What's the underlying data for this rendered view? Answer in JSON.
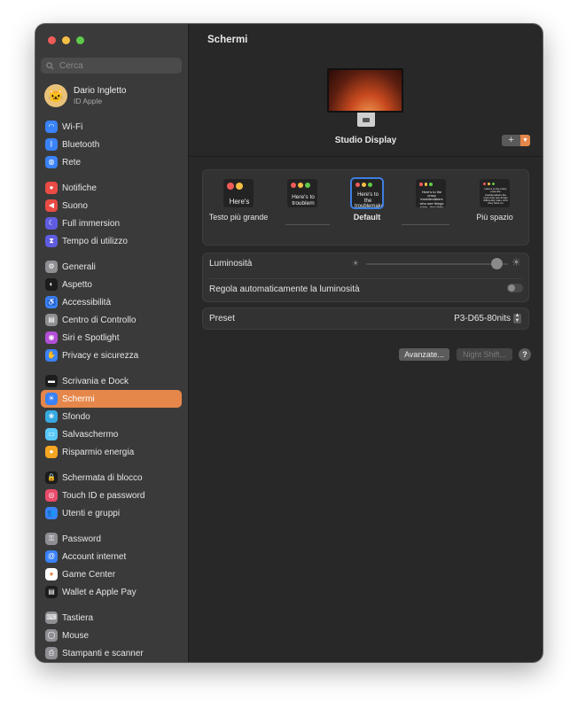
{
  "search": {
    "placeholder": "Cerca"
  },
  "account": {
    "name": "Dario Ingletto",
    "subtitle": "ID Apple"
  },
  "sidebar": {
    "groups": [
      [
        {
          "label": "Wi-Fi",
          "icon": "wifi-icon",
          "color": "#3a82f7"
        },
        {
          "label": "Bluetooth",
          "icon": "bluetooth-icon",
          "color": "#3a82f7"
        },
        {
          "label": "Rete",
          "icon": "globe-icon",
          "color": "#3a82f7"
        }
      ],
      [
        {
          "label": "Notifiche",
          "icon": "bell-icon",
          "color": "#ea4b45"
        },
        {
          "label": "Suono",
          "icon": "speaker-icon",
          "color": "#ea4b45"
        },
        {
          "label": "Full immersion",
          "icon": "moon-icon",
          "color": "#5f5ce0"
        },
        {
          "label": "Tempo di utilizzo",
          "icon": "hourglass-icon",
          "color": "#5f5ce0"
        }
      ],
      [
        {
          "label": "Generali",
          "icon": "gear-icon",
          "color": "#8e8e93"
        },
        {
          "label": "Aspetto",
          "icon": "appearance-icon",
          "color": "#1c1c1c"
        },
        {
          "label": "Accessibilità",
          "icon": "accessibility-icon",
          "color": "#3a82f7"
        },
        {
          "label": "Centro di Controllo",
          "icon": "control-center-icon",
          "color": "#8e8e93"
        },
        {
          "label": "Siri e Spotlight",
          "icon": "siri-icon",
          "color": "#b34fd6"
        },
        {
          "label": "Privacy e sicurezza",
          "icon": "hand-icon",
          "color": "#3a82f7"
        }
      ],
      [
        {
          "label": "Scrivania e Dock",
          "icon": "dock-icon",
          "color": "#1c1c1c"
        },
        {
          "label": "Schermi",
          "icon": "display-icon",
          "color": "#3a82f7",
          "active": true
        },
        {
          "label": "Sfondo",
          "icon": "wallpaper-icon",
          "color": "#36a9e1"
        },
        {
          "label": "Salvaschermo",
          "icon": "screensaver-icon",
          "color": "#5ac8fa"
        },
        {
          "label": "Risparmio energia",
          "icon": "bulb-icon",
          "color": "#f5a623"
        }
      ],
      [
        {
          "label": "Schermata di blocco",
          "icon": "lock-icon",
          "color": "#1c1c1c"
        },
        {
          "label": "Touch ID e password",
          "icon": "fingerprint-icon",
          "color": "#ea4b6a"
        },
        {
          "label": "Utenti e gruppi",
          "icon": "users-icon",
          "color": "#3a82f7"
        }
      ],
      [
        {
          "label": "Password",
          "icon": "key-icon",
          "color": "#8e8e93"
        },
        {
          "label": "Account internet",
          "icon": "at-icon",
          "color": "#3a82f7"
        },
        {
          "label": "Game Center",
          "icon": "game-center-icon",
          "color": "#ffffff"
        },
        {
          "label": "Wallet e Apple Pay",
          "icon": "wallet-icon",
          "color": "#1c1c1c"
        }
      ],
      [
        {
          "label": "Tastiera",
          "icon": "keyboard-icon",
          "color": "#8e8e93"
        },
        {
          "label": "Mouse",
          "icon": "mouse-icon",
          "color": "#8e8e93"
        },
        {
          "label": "Stampanti e scanner",
          "icon": "printer-icon",
          "color": "#8e8e93"
        }
      ]
    ]
  },
  "main": {
    "title": "Schermi",
    "display_name": "Studio Display",
    "add_button": "+",
    "resolutions": [
      {
        "label": "Testo più grande",
        "preview": "Here's"
      },
      {
        "label": "",
        "preview": "Here's to troublem"
      },
      {
        "label": "Default",
        "preview": "Here's to the troublemakers ones who",
        "selected": true
      },
      {
        "label": "",
        "preview": "Here's to the crazy troublemakers who see things rules. And they"
      },
      {
        "label": "Più spazio",
        "preview": "Here's to the crazy ones the troublemakers the ones who see things differently rules. And they have no"
      }
    ],
    "brightness": {
      "label": "Luminosità",
      "level": 0.92
    },
    "auto_brightness": {
      "label": "Regola automaticamente la luminosità",
      "enabled": false
    },
    "preset": {
      "label": "Preset",
      "value": "P3-D65-80nits"
    },
    "buttons": {
      "advanced": "Avanzate...",
      "night_shift": "Night Shift...",
      "help": "?"
    }
  }
}
